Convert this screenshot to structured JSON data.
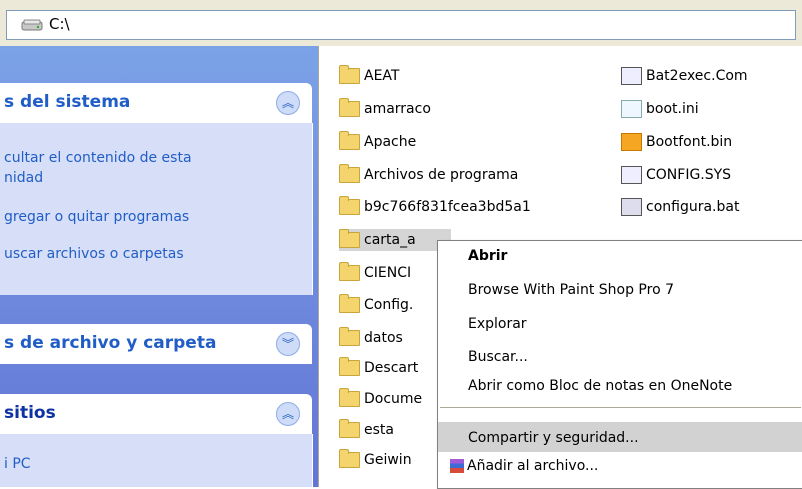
{
  "address": {
    "path": "C:\\"
  },
  "left_panel": {
    "system_tasks": {
      "title": "s del sistema",
      "items": [
        "cultar el contenido de esta",
        "nidad",
        "gregar o quitar programas",
        "uscar archivos o carpetas"
      ]
    },
    "file_tasks": {
      "title": "s de archivo y carpeta"
    },
    "other_places": {
      "title": " sitios",
      "items": [
        "i PC"
      ]
    }
  },
  "files": {
    "col1": [
      "AEAT",
      "amarraco",
      "Apache",
      "Archivos de programa",
      "b9c766f831fcea3bd5a1",
      "carta_a",
      "CIENCI",
      "Config.",
      "datos",
      "Descart",
      "Docume",
      "esta",
      "Geiwin"
    ],
    "col2": [
      "Bat2exec.Com",
      "boot.ini",
      "Bootfont.bin",
      "CONFIG.SYS",
      "configura.bat"
    ]
  },
  "context_menu": {
    "items": [
      "Abrir",
      "Browse With Paint Shop Pro 7",
      "Explorar",
      "Buscar...",
      "Abrir como Bloc de notas en OneNote",
      "Compartir y seguridad...",
      "Añadir al archivo..."
    ]
  }
}
